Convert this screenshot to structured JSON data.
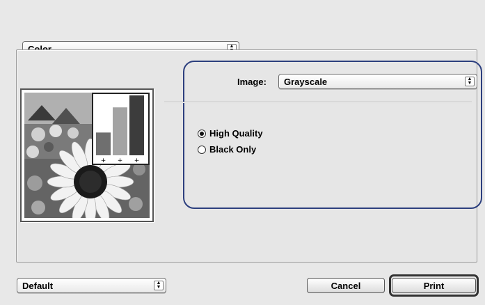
{
  "color_popup": {
    "value": "Color"
  },
  "image_field": {
    "label": "Image:",
    "value": "Grayscale"
  },
  "quality_options": [
    {
      "label": "High Quality",
      "selected": true
    },
    {
      "label": "Black Only",
      "selected": false
    }
  ],
  "preview": {
    "chart_bars": [
      0.38,
      0.8,
      1.0
    ],
    "colors": {
      "bar1": "#6f6f6f",
      "bar2": "#a3a3a3",
      "bar3": "#3c3c3c"
    }
  },
  "preset_popup": {
    "value": "Default"
  },
  "buttons": {
    "cancel": "Cancel",
    "print": "Print"
  },
  "colors": {
    "highlight_border": "#2c3f7e",
    "background": "#e6e6e6"
  }
}
